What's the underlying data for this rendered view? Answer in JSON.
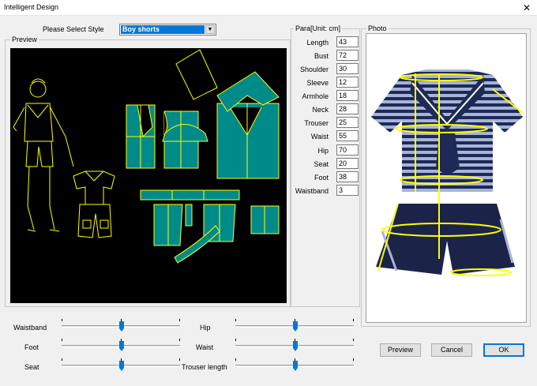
{
  "window": {
    "title": "Intelligent Design",
    "close_glyph": "✕"
  },
  "style_selector": {
    "label": "Please Select Style",
    "value": "Boy shorts"
  },
  "preview": {
    "title": "Preview"
  },
  "para": {
    "title": "Para[Unit: cm]",
    "rows": [
      {
        "label": "Length",
        "value": "43"
      },
      {
        "label": "Bust",
        "value": "72"
      },
      {
        "label": "Shoulder",
        "value": "30"
      },
      {
        "label": "Sleeve",
        "value": "12"
      },
      {
        "label": "Armhole",
        "value": "18"
      },
      {
        "label": "Neck",
        "value": "28"
      },
      {
        "label": "Trouser",
        "value": "25"
      },
      {
        "label": "Waist",
        "value": "55"
      },
      {
        "label": "Hip",
        "value": "70"
      },
      {
        "label": "Seat",
        "value": "20"
      },
      {
        "label": "Foot",
        "value": "38"
      },
      {
        "label": "Waistband",
        "value": "3"
      }
    ]
  },
  "photo": {
    "title": "Photo"
  },
  "sliders": {
    "waistband": "Waistband",
    "foot": "Foot",
    "seat": "Seat",
    "hip": "Hip",
    "waist": "Waist",
    "trouser_length": "Trouser length"
  },
  "buttons": {
    "preview": "Preview",
    "cancel": "Cancel",
    "ok": "OK"
  },
  "colors": {
    "pattern_fill": "#008b8b",
    "pattern_stroke": "#ffff00",
    "canvas_bg": "#000000",
    "shirt_stripe": "#1e2a56",
    "shirt_light": "#a7b4d8",
    "shorts": "#1b2448",
    "selection": "#0078d7"
  }
}
